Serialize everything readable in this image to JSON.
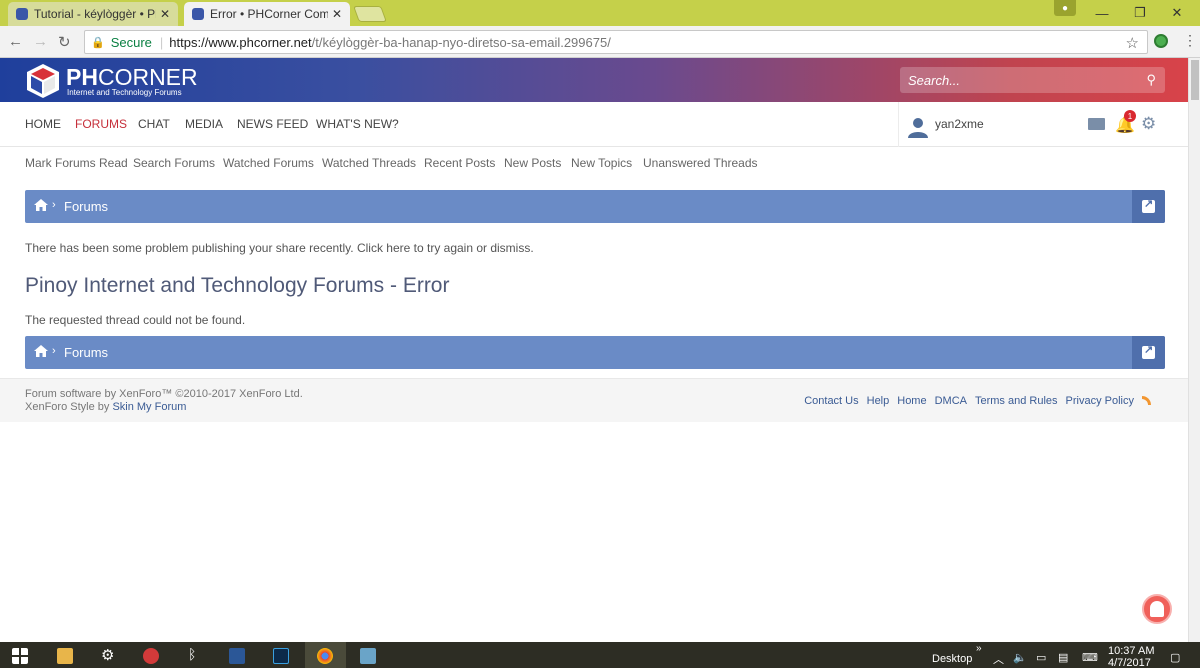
{
  "browser": {
    "tabs": [
      {
        "label": "Tutorial - kéylòggèr • Ph"
      },
      {
        "label": "Error • PHCorner Comm"
      }
    ],
    "secure_label": "Secure",
    "url_host": "https://www.phcorner.net",
    "url_path": "/t/kéylòggèr-ba-hanap-nyo-diretso-sa-email.299675/"
  },
  "site": {
    "logo_bold": "PH",
    "logo_light": "CORNER",
    "tagline": "Internet and Technology Forums",
    "search_placeholder": "Search...",
    "nav": [
      {
        "label": "HOME"
      },
      {
        "label": "FORUMS"
      },
      {
        "label": "CHAT"
      },
      {
        "label": "MEDIA"
      },
      {
        "label": "NEWS FEED"
      },
      {
        "label": "WHAT'S NEW?"
      }
    ],
    "username": "yan2xme",
    "notification_count": "1",
    "subnav": [
      {
        "label": "Mark Forums Read"
      },
      {
        "label": "Search Forums"
      },
      {
        "label": "Watched Forums"
      },
      {
        "label": "Watched Threads"
      },
      {
        "label": "Recent Posts"
      },
      {
        "label": "New Posts"
      },
      {
        "label": "New Topics"
      },
      {
        "label": "Unanswered Threads"
      }
    ],
    "breadcrumb_label": "Forums",
    "notice": "There has been some problem publishing your share recently. Click here to try again or dismiss.",
    "page_title": "Pinoy Internet and Technology Forums - Error",
    "error_message": "The requested thread could not be found.",
    "footer": {
      "software": "Forum software by XenForo™ ©2010-2017 XenForo Ltd.",
      "style_prefix": "XenForo Style by ",
      "style_link": "Skin My Forum",
      "links": [
        {
          "label": "Contact Us"
        },
        {
          "label": "Help"
        },
        {
          "label": "Home"
        },
        {
          "label": "DMCA"
        },
        {
          "label": "Terms and Rules"
        },
        {
          "label": "Privacy Policy"
        }
      ]
    }
  },
  "taskbar": {
    "desktop_label": "Desktop",
    "time": "10:37 AM",
    "date": "4/7/2017"
  },
  "colors": {
    "accent_red": "#c62f3a",
    "breadcrumb_blue": "#6a8bc6",
    "link_blue": "#3a5b94"
  }
}
